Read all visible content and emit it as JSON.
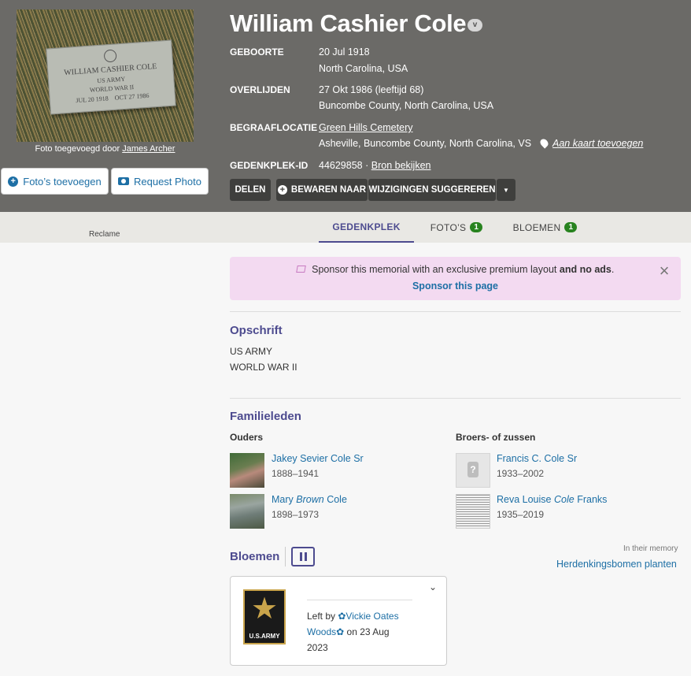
{
  "photo": {
    "stone_lines": [
      "WILLIAM CASHIER COLE",
      "US ARMY",
      "WORLD WAR II",
      "JUL 20 1918    OCT 27 1986"
    ],
    "caption_prefix": "Foto toegevoegd door",
    "caption_author": "James Archer"
  },
  "buttons": {
    "add_photos": "Foto’s toevoegen",
    "request_photo": "Request Photo",
    "share": "DELEN",
    "save_to": "BEWAREN NAAR",
    "suggest_edits": "WIJZIGINGEN SUGGEREREN"
  },
  "person": {
    "name": "William Cashier Cole",
    "badge": "v",
    "birth_label": "GEBOORTE",
    "birth_date": "20 Jul 1918",
    "birth_place": "North Carolina, USA",
    "death_label": "OVERLIJDEN",
    "death_date": "27 Okt 1986 (leeftijd 68)",
    "death_place": "Buncombe County, North Carolina, USA",
    "burial_label": "BEGRAAFLOCATIE",
    "cemetery": "Green Hills Cemetery",
    "burial_place": "Asheville, Buncombe County, North Carolina, VS",
    "add_map": "Aan kaart toevoegen",
    "memorial_label": "GEDENKPLEK-ID",
    "memorial_id": "44629858 ·",
    "source": "Bron bekijken"
  },
  "tabs": {
    "memorial": "GEDENKPLEK",
    "photos": "FOTO’S",
    "photos_count": "1",
    "flowers": "BLOEMEN",
    "flowers_count": "1",
    "ad": "Reclame"
  },
  "sponsor": {
    "text": "Sponsor this memorial with an exclusive premium layout",
    "bold": "and no ads",
    "link": "Sponsor this page"
  },
  "inscription": {
    "title": "Opschrift",
    "lines": [
      "US ARMY",
      "WORLD WAR II"
    ]
  },
  "family": {
    "title": "Familieleden",
    "parents_label": "Ouders",
    "siblings_label": "Broers- of zussen",
    "parents": [
      {
        "name": "Jakey Sevier Cole Sr",
        "dates": "1888–1941"
      },
      {
        "first": "Mary",
        "maiden": "Brown",
        "last": "Cole",
        "dates": "1898–1973"
      }
    ],
    "siblings": [
      {
        "name": "Francis C. Cole Sr",
        "dates": "1933–2002"
      },
      {
        "first": "Reva Louise",
        "maiden": "Cole",
        "last": "Franks",
        "dates": "1935–2019"
      }
    ]
  },
  "flowers": {
    "title": "Bloemen",
    "memory_label": "In their memory",
    "trees_link": "Herdenkingsbomen planten",
    "card": {
      "emblem_label": "U.S.ARMY",
      "left_by": "Left by",
      "author_line1": "✿Vickie Oates",
      "author_line2": "Woods✿",
      "on_date": "on 23 Aug",
      "year": "2023"
    }
  }
}
